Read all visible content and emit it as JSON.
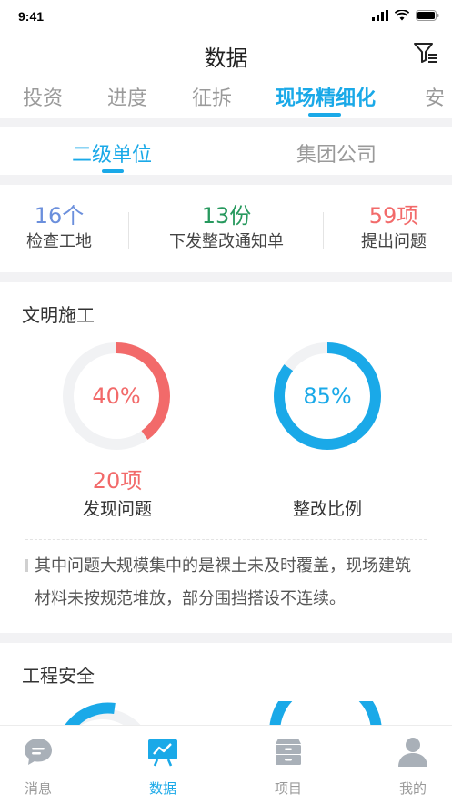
{
  "status": {
    "time": "9:41"
  },
  "header": {
    "title": "数据"
  },
  "tabs": [
    {
      "label": "投资"
    },
    {
      "label": "进度"
    },
    {
      "label": "征拆"
    },
    {
      "label": "现场精细化"
    },
    {
      "label": "安"
    }
  ],
  "subtabs": [
    {
      "label": "二级单位"
    },
    {
      "label": "集团公司"
    }
  ],
  "stats": [
    {
      "value": "16个",
      "label": "检查工地",
      "color": "#6b8fdc"
    },
    {
      "value": "13份",
      "label": "下发整改通知单",
      "color": "#27995e"
    },
    {
      "value": "59项",
      "label": "提出问题",
      "color": "#f26a6a"
    }
  ],
  "civilized": {
    "title": "文明施工",
    "rings": [
      {
        "percent_text": "40%",
        "fraction": 0.4,
        "color": "#f26a6a",
        "count": "20项",
        "label": "发现问题"
      },
      {
        "percent_text": "85%",
        "fraction": 0.85,
        "color": "#1aa9e8",
        "label": "整改比例"
      }
    ],
    "note": "其中问题大规模集中的是裸土未及时覆盖，现场建筑材料未按规范堆放，部分围挡搭设不连续。"
  },
  "safety": {
    "title": "工程安全"
  },
  "bottom_nav": [
    {
      "label": "消息",
      "icon": "message-icon"
    },
    {
      "label": "数据",
      "icon": "chart-board-icon"
    },
    {
      "label": "项目",
      "icon": "archive-icon"
    },
    {
      "label": "我的",
      "icon": "user-icon"
    }
  ],
  "colors": {
    "accent": "#1aa9e8",
    "ring_track": "#f1f2f4"
  }
}
